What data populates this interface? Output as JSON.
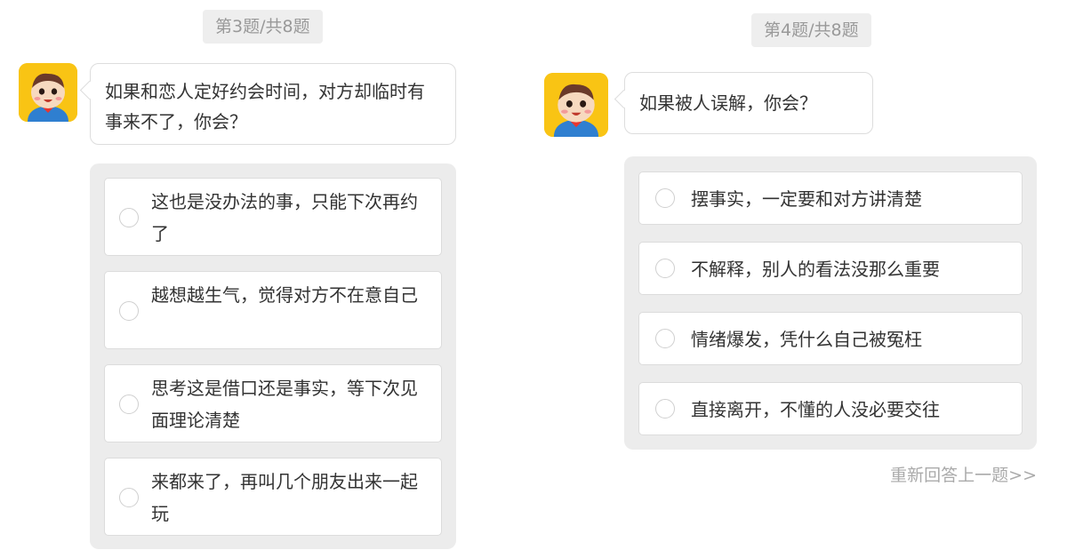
{
  "question_left": {
    "progress": "第3题/共8题",
    "prompt": "如果和恋人定好约会时间，对方却临时有事来不了，你会？",
    "options": [
      "这也是没办法的事，只能下次再约了",
      "越想越生气，觉得对方不在意自己",
      "思考这是借口还是事实，等下次见面理论清楚",
      "来都来了，再叫几个朋友出来一起玩"
    ]
  },
  "question_right": {
    "progress": "第4题/共8题",
    "prompt": "如果被人误解，你会？",
    "options": [
      "摆事实，一定要和对方讲清楚",
      "不解释，别人的看法没那么重要",
      "情绪爆发，凭什么自己被冤枉",
      "直接离开，不懂的人没必要交往"
    ]
  },
  "redo_link": "重新回答上一题>>",
  "avatar_icon": "cartoon-boy-avatar-icon",
  "colors": {
    "avatar_bg": "#f9c414",
    "options_panel_bg": "#ececec",
    "progress_bg": "#eeeeee",
    "muted_text": "#999999"
  }
}
